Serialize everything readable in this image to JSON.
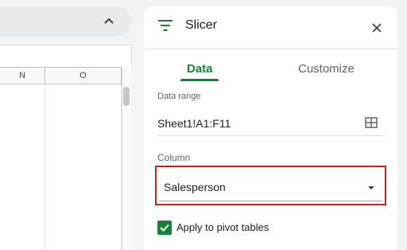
{
  "sheet": {
    "column_headers": [
      "N",
      "O"
    ]
  },
  "panel": {
    "title": "Slicer",
    "icons": {
      "header": "filter-icon",
      "close": "close-icon",
      "range": "grid-select-icon",
      "dropdown": "dropdown-arrow-icon",
      "collapse": "chevron-up-icon"
    },
    "tabs": [
      {
        "label": "Data",
        "active": true
      },
      {
        "label": "Customize",
        "active": false
      }
    ],
    "data_range": {
      "label": "Data range",
      "value": "Sheet1!A1:F11"
    },
    "column": {
      "label": "Column",
      "selected": "Salesperson"
    },
    "pivot_option": {
      "label": "Apply to pivot tables",
      "checked": true
    }
  },
  "colors": {
    "accent": "#188038",
    "highlight": "#c5221f"
  }
}
